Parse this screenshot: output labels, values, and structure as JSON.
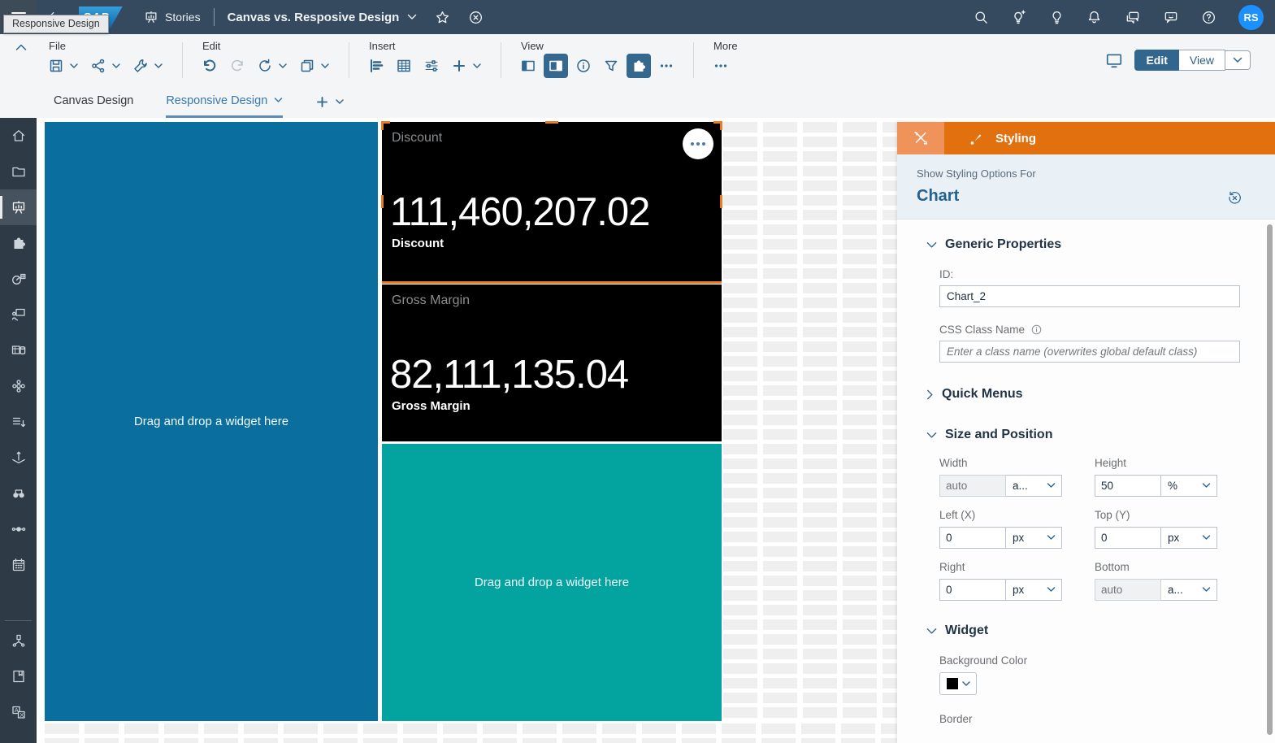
{
  "shellbar": {
    "brand": "SAP",
    "product": "Stories",
    "title": "Canvas vs. Resposive Design",
    "avatar": "RS"
  },
  "tooltip": {
    "text": "Responsive Design"
  },
  "toolbar": {
    "groups": {
      "file": "File",
      "edit": "Edit",
      "insert": "Insert",
      "view": "View",
      "more": "More"
    },
    "mode_edit": "Edit",
    "mode_view": "View"
  },
  "tabs": {
    "canvas": "Canvas Design",
    "responsive": "Responsive Design"
  },
  "canvas": {
    "left_placeholder": "Drag and drop a widget here",
    "teal_placeholder": "Drag and drop a widget here",
    "kpis": [
      {
        "title": "Discount",
        "value": "111,460,207.02",
        "label": "Discount"
      },
      {
        "title": "Gross Margin",
        "value": "82,111,135.04",
        "label": "Gross Margin"
      }
    ]
  },
  "styling": {
    "tab_label": "Styling",
    "show_for": "Show Styling Options For",
    "target": "Chart",
    "sections": {
      "generic": "Generic Properties",
      "quick": "Quick Menus",
      "size": "Size and Position",
      "widget": "Widget"
    },
    "id_label": "ID:",
    "id_value": "Chart_2",
    "css_label": "CSS Class Name",
    "css_placeholder": "Enter a class name (overwrites global default class)",
    "size_fields": [
      {
        "label": "Width",
        "value": "auto",
        "unit": "a..."
      },
      {
        "label": "Height",
        "value": "50",
        "unit": "%"
      },
      {
        "label": "Left (X)",
        "value": "0",
        "unit": "px"
      },
      {
        "label": "Top (Y)",
        "value": "0",
        "unit": "px"
      },
      {
        "label": "Right",
        "value": "0",
        "unit": "px"
      },
      {
        "label": "Bottom",
        "value": "auto",
        "unit": "a..."
      }
    ],
    "bg_color_label": "Background Color",
    "bg_color_value": "#000000",
    "border_label": "Border"
  },
  "colors": {
    "shellbar": "#354a5f",
    "accent_orange": "#e2700f",
    "selection_orange": "#ee7a23",
    "widget_blue": "#0a6e9e",
    "widget_teal": "#03a3a0",
    "active_button": "#35688f",
    "avatar_blue": "#1b90ff"
  }
}
